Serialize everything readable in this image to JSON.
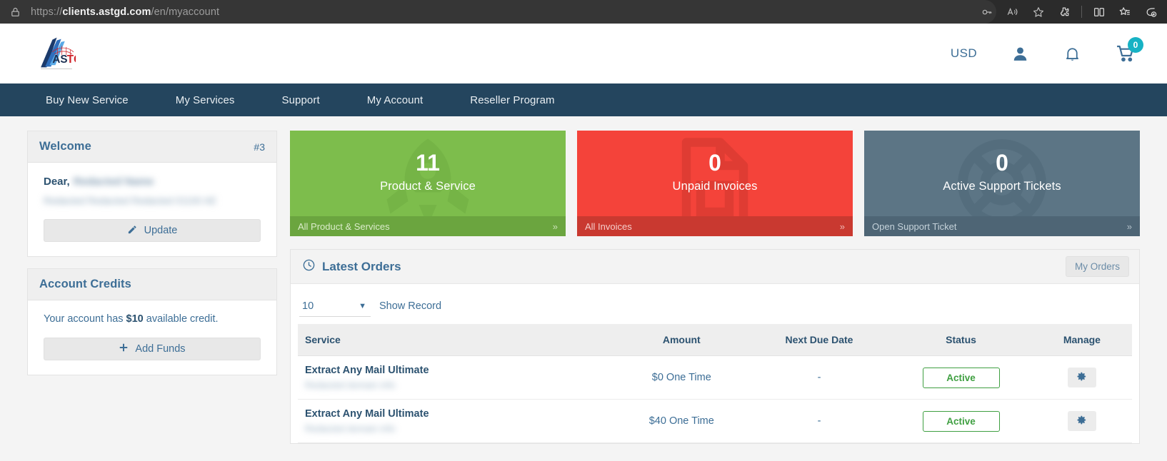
{
  "browser": {
    "url_scheme": "https://",
    "url_host": "clients.astgd.com",
    "url_path": "/en/myaccount",
    "icons": [
      {
        "name": "password-key-icon"
      },
      {
        "name": "read-aloud-icon"
      },
      {
        "name": "favorite-star-icon"
      },
      {
        "name": "extensions-puzzle-icon"
      },
      {
        "name": "split-screen-icon"
      },
      {
        "name": "collections-icon"
      },
      {
        "name": "add-tab-icon"
      }
    ]
  },
  "header": {
    "logo_alt": "ASTGD",
    "logo_text_dark": "AS",
    "logo_text_red": "TGD",
    "currency": "USD",
    "account_icon": "user-icon",
    "notification_icon": "bell-icon",
    "cart_icon": "cart-icon",
    "cart_count": "0",
    "cart_badge_color": "#17b2c4"
  },
  "nav": {
    "items": [
      {
        "label": "Buy New Service"
      },
      {
        "label": "My Services"
      },
      {
        "label": "Support"
      },
      {
        "label": "My Account"
      },
      {
        "label": "Reseller Program"
      }
    ]
  },
  "welcome_card": {
    "title": "Welcome",
    "badge": "#3",
    "greeting": "Dear,",
    "customer_name": "Redacted Name",
    "address": "Redacted  Redacted  Redacted  01100  AE",
    "update_label": "Update",
    "update_icon": "pencil-icon"
  },
  "credits_card": {
    "title": "Account Credits",
    "text_before": "Your account has ",
    "amount": "$10",
    "text_after": " available credit.",
    "add_funds_label": "Add Funds",
    "add_funds_icon": "plus-icon"
  },
  "tiles": [
    {
      "count": "11",
      "label": "Product & Service",
      "footer": "All Product & Services",
      "chevron": "»",
      "color": "#7dbd4c",
      "footer_color": "#6ba53f",
      "watermark": "rocket-icon"
    },
    {
      "count": "0",
      "label": "Unpaid Invoices",
      "footer": "All Invoices",
      "chevron": "»",
      "color": "#f4433a",
      "footer_color": "#c93930",
      "watermark": "invoice-icon"
    },
    {
      "count": "0",
      "label": "Active Support Tickets",
      "footer": "Open Support Ticket",
      "chevron": "»",
      "color": "#5c7585",
      "footer_color": "#4e6575",
      "watermark": "life-ring-icon"
    }
  ],
  "orders_panel": {
    "title": "Latest Orders",
    "title_icon": "clock-icon",
    "my_orders_label": "My Orders",
    "records_value": "10",
    "records_label": "Show Record",
    "columns": [
      "Service",
      "Amount",
      "Next Due Date",
      "Status",
      "Manage"
    ],
    "rows": [
      {
        "service": "Extract Any Mail Ultimate",
        "service_sub": "Redacted domain info",
        "amount": "$0 One Time",
        "next_due_date": "-",
        "status": "Active",
        "manage_icon": "gear-icon"
      },
      {
        "service": "Extract Any Mail Ultimate",
        "service_sub": "Redacted domain info",
        "amount": "$40 One Time",
        "next_due_date": "-",
        "status": "Active",
        "manage_icon": "gear-icon"
      }
    ]
  }
}
